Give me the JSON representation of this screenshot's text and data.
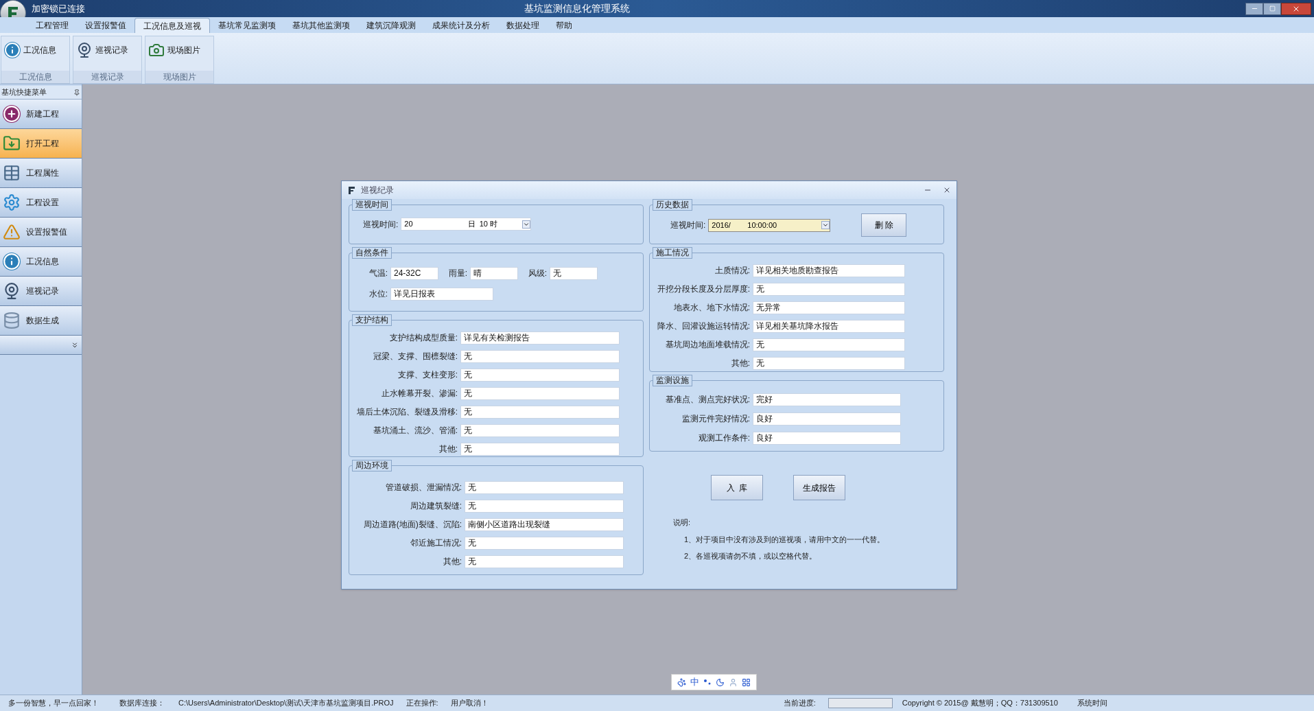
{
  "title_bar": {
    "app_status": "加密锁已连接",
    "title": "基坑监测信息化管理系统"
  },
  "menu": [
    {
      "label": "工程管理",
      "selected": false
    },
    {
      "label": "设置报警值",
      "selected": false
    },
    {
      "label": "工况信息及巡视",
      "selected": true
    },
    {
      "label": "基坑常见监测项",
      "selected": false
    },
    {
      "label": "基坑其他监测项",
      "selected": false
    },
    {
      "label": "建筑沉降观测",
      "selected": false
    },
    {
      "label": "成果统计及分析",
      "selected": false
    },
    {
      "label": "数据处理",
      "selected": false
    },
    {
      "label": "帮助",
      "selected": false
    }
  ],
  "ribbon_groups": [
    {
      "kind": "info",
      "button": "工况信息",
      "caption": "工况信息"
    },
    {
      "kind": "webcam",
      "button": "巡视记录",
      "caption": "巡视记录"
    },
    {
      "kind": "camera",
      "button": "现场图片",
      "caption": "现场图片"
    }
  ],
  "sidebar": {
    "title": "基坑快捷菜单",
    "items": [
      {
        "kind": "new",
        "label": "新建工程",
        "selected": false
      },
      {
        "kind": "open",
        "label": "打开工程",
        "selected": true
      },
      {
        "kind": "table",
        "label": "工程属性",
        "selected": false
      },
      {
        "kind": "gear",
        "label": "工程设置",
        "selected": false
      },
      {
        "kind": "warning",
        "label": "设置报警值",
        "selected": false
      },
      {
        "kind": "info",
        "label": "工况信息",
        "selected": false
      },
      {
        "kind": "webcam",
        "label": "巡视记录",
        "selected": false
      },
      {
        "kind": "database",
        "label": "数据生成",
        "selected": false
      }
    ]
  },
  "dialog": {
    "title": "巡视纪录",
    "patrol_time": {
      "legend": "巡视时间",
      "label": "巡视时间:",
      "value": "20",
      "suffix": "日  10 时"
    },
    "natural_conditions": {
      "legend": "自然条件",
      "fields": [
        {
          "label": "气温:",
          "value": "24-32C"
        },
        {
          "label": "雨量:",
          "value": "晴"
        },
        {
          "label": "风级:",
          "value": "无"
        },
        {
          "label": "水位:",
          "value": "详见日报表"
        }
      ]
    },
    "support_structure": {
      "legend": "支护结构",
      "fields": [
        {
          "label": "支护结构成型质量:",
          "value": "详见有关检测报告"
        },
        {
          "label": "冠梁、支撑、围檩裂缝:",
          "value": "无"
        },
        {
          "label": "支撑、支柱变形:",
          "value": "无"
        },
        {
          "label": "止水帷幕开裂、渗漏:",
          "value": "无"
        },
        {
          "label": "墙后土体沉陷、裂缝及滑移:",
          "value": "无"
        },
        {
          "label": "基坑涌土、流沙、管涌:",
          "value": "无"
        },
        {
          "label": "其他:",
          "value": "无"
        }
      ]
    },
    "surroundings": {
      "legend": "周边环境",
      "fields": [
        {
          "label": "管道破损、泄漏情况:",
          "value": "无"
        },
        {
          "label": "周边建筑裂缝:",
          "value": "无"
        },
        {
          "label": "周边道路(地面)裂缝、沉陷:",
          "value": "南侧小区道路出现裂缝"
        },
        {
          "label": "邻近施工情况:",
          "value": "无"
        },
        {
          "label": "其他:",
          "value": "无"
        }
      ]
    },
    "history": {
      "legend": "历史数据",
      "label": "巡视时间:",
      "value": "2016/        10:00:00",
      "button": "删 除"
    },
    "construction": {
      "legend": "施工情况",
      "fields": [
        {
          "label": "土质情况:",
          "value": "详见相关地质勘查报告"
        },
        {
          "label": "开挖分段长度及分层厚度:",
          "value": "无"
        },
        {
          "label": "地表水、地下水情况:",
          "value": "无异常"
        },
        {
          "label": "降水、回灌设施运转情况:",
          "value": "详见相关基坑降水报告"
        },
        {
          "label": "基坑周边地面堆载情况:",
          "value": "无"
        },
        {
          "label": "其他:",
          "value": "无"
        }
      ]
    },
    "monitoring": {
      "legend": "监测设施",
      "fields": [
        {
          "label": "基准点、测点完好状况:",
          "value": "完好"
        },
        {
          "label": "监测元件完好情况:",
          "value": "良好"
        },
        {
          "label": "观测工作条件:",
          "value": "良好"
        }
      ]
    },
    "buttons": [
      "入  库",
      "生成报告"
    ],
    "notes": {
      "heading": "说明:",
      "lines": [
        "1、对于项目中没有涉及到的巡视项，请用中文的一一代替。",
        "2、各巡视项请勿不填，或以空格代替。"
      ]
    }
  },
  "ime_bar": {
    "mode": "中"
  },
  "status_bar": {
    "motto": "多一份智慧，早一点回家！",
    "db_label": "数据库连接：",
    "db_path": "C:\\Users\\Administrator\\Desktop\\测试\\天津市基坑监测项目.PROJ",
    "op_label": "正在操作:",
    "op_value": "用户取消！",
    "progress_label": "当前进度:",
    "copyright": "Copyright © 2015@ 戴慧明；QQ：731309510",
    "time_label": "系统时间"
  }
}
